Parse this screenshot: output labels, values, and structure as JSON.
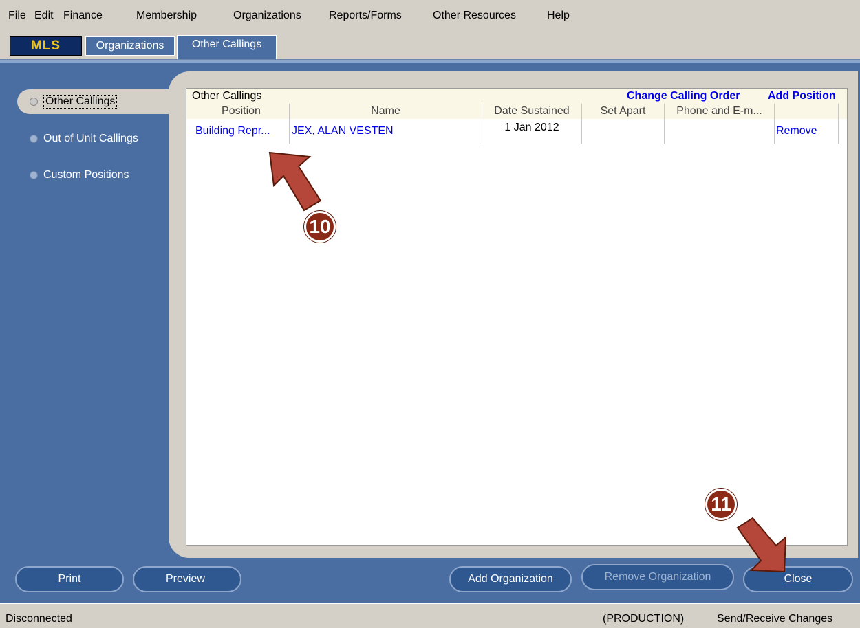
{
  "menu": [
    "File",
    "Edit",
    "Finance",
    "Membership",
    "Organizations",
    "Reports/Forms",
    "Other Resources",
    "Help"
  ],
  "tabs": {
    "app": "MLS",
    "organizations": "Organizations",
    "other_callings": "Other Callings"
  },
  "sidebar": {
    "items": [
      {
        "label": "Other Callings",
        "active": true
      },
      {
        "label": "Out of Unit Callings",
        "active": false
      },
      {
        "label": "Custom Positions",
        "active": false
      }
    ]
  },
  "panel": {
    "title": "Other Callings",
    "change_order_link": "Change Calling Order",
    "add_position_link": "Add Position",
    "columns": [
      "Position",
      "Name",
      "Date Sustained",
      "Set Apart",
      "Phone and E-m..."
    ],
    "rows": [
      {
        "position": "Building Repr...",
        "name": "JEX, ALAN VESTEN",
        "date_sustained": "1 Jan 2012",
        "set_apart": "",
        "phone": "",
        "action": "Remove"
      }
    ]
  },
  "buttons": {
    "print": "Print",
    "preview": "Preview",
    "add_org": "Add Organization",
    "remove_org": "Remove Organization",
    "close": "Close"
  },
  "status": {
    "left": "Disconnected",
    "env": "(PRODUCTION)",
    "send_receive": "Send/Receive Changes"
  },
  "annotations": {
    "step_a": "10",
    "step_b": "11"
  },
  "colors": {
    "panel_blue": "#4a6ea2",
    "link": "#0000ee",
    "annotation_red": "#8b2a16"
  }
}
